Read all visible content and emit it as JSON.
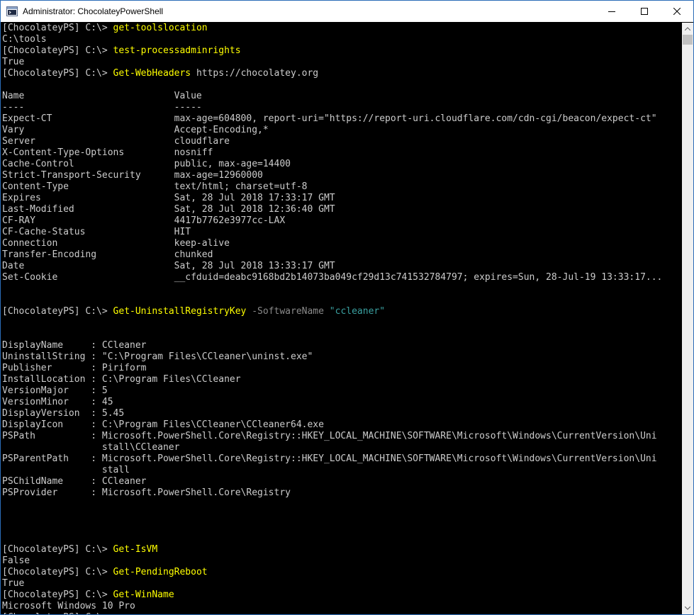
{
  "window": {
    "title": "Administrator: ChocolateyPowerShell",
    "icons": {
      "app": "powershell-app-icon",
      "minimize": "minimize-icon",
      "maximize": "maximize-icon",
      "close": "close-icon"
    }
  },
  "console": {
    "colors": {
      "background": "#000000",
      "text": "#cccccc",
      "command": "#ffff00",
      "parameter": "#8a8a8a",
      "string": "#3aa0a0"
    },
    "lines": [
      [
        {
          "t": "[ChocolateyPS] C:\\> "
        },
        {
          "t": "get-toolslocation",
          "c": "cmd"
        }
      ],
      [
        {
          "t": "C:\\tools"
        }
      ],
      [
        {
          "t": "[ChocolateyPS] C:\\> "
        },
        {
          "t": "test-processadminrights",
          "c": "cmd"
        }
      ],
      [
        {
          "t": "True"
        }
      ],
      [
        {
          "t": "[ChocolateyPS] C:\\> "
        },
        {
          "t": "Get-WebHeaders",
          "c": "cmd"
        },
        {
          "t": " https://chocolatey.org"
        }
      ],
      [
        {
          "t": ""
        }
      ],
      [
        {
          "t": "Name                           Value"
        }
      ],
      [
        {
          "t": "----                           -----"
        }
      ],
      [
        {
          "t": "Expect-CT                      max-age=604800, report-uri=\"https://report-uri.cloudflare.com/cdn-cgi/beacon/expect-ct\""
        }
      ],
      [
        {
          "t": "Vary                           Accept-Encoding,*"
        }
      ],
      [
        {
          "t": "Server                         cloudflare"
        }
      ],
      [
        {
          "t": "X-Content-Type-Options         nosniff"
        }
      ],
      [
        {
          "t": "Cache-Control                  public, max-age=14400"
        }
      ],
      [
        {
          "t": "Strict-Transport-Security      max-age=12960000"
        }
      ],
      [
        {
          "t": "Content-Type                   text/html; charset=utf-8"
        }
      ],
      [
        {
          "t": "Expires                        Sat, 28 Jul 2018 17:33:17 GMT"
        }
      ],
      [
        {
          "t": "Last-Modified                  Sat, 28 Jul 2018 12:36:40 GMT"
        }
      ],
      [
        {
          "t": "CF-RAY                         4417b7762e3977cc-LAX"
        }
      ],
      [
        {
          "t": "CF-Cache-Status                HIT"
        }
      ],
      [
        {
          "t": "Connection                     keep-alive"
        }
      ],
      [
        {
          "t": "Transfer-Encoding              chunked"
        }
      ],
      [
        {
          "t": "Date                           Sat, 28 Jul 2018 13:33:17 GMT"
        }
      ],
      [
        {
          "t": "Set-Cookie                     __cfduid=deabc9168bd2b14073ba049cf29d13c741532784797; expires=Sun, 28-Jul-19 13:33:17..."
        }
      ],
      [
        {
          "t": ""
        }
      ],
      [
        {
          "t": ""
        }
      ],
      [
        {
          "t": "[ChocolateyPS] C:\\> "
        },
        {
          "t": "Get-UninstallRegistryKey",
          "c": "cmd"
        },
        {
          "t": " -SoftwareName",
          "c": "param"
        },
        {
          "t": " "
        },
        {
          "t": "\"ccleaner\"",
          "c": "str"
        }
      ],
      [
        {
          "t": ""
        }
      ],
      [
        {
          "t": ""
        }
      ],
      [
        {
          "t": "DisplayName     : CCleaner"
        }
      ],
      [
        {
          "t": "UninstallString : \"C:\\Program Files\\CCleaner\\uninst.exe\""
        }
      ],
      [
        {
          "t": "Publisher       : Piriform"
        }
      ],
      [
        {
          "t": "InstallLocation : C:\\Program Files\\CCleaner"
        }
      ],
      [
        {
          "t": "VersionMajor    : 5"
        }
      ],
      [
        {
          "t": "VersionMinor    : 45"
        }
      ],
      [
        {
          "t": "DisplayVersion  : 5.45"
        }
      ],
      [
        {
          "t": "DisplayIcon     : C:\\Program Files\\CCleaner\\CCleaner64.exe"
        }
      ],
      [
        {
          "t": "PSPath          : Microsoft.PowerShell.Core\\Registry::HKEY_LOCAL_MACHINE\\SOFTWARE\\Microsoft\\Windows\\CurrentVersion\\Uni"
        }
      ],
      [
        {
          "t": "                  stall\\CCleaner"
        }
      ],
      [
        {
          "t": "PSParentPath    : Microsoft.PowerShell.Core\\Registry::HKEY_LOCAL_MACHINE\\SOFTWARE\\Microsoft\\Windows\\CurrentVersion\\Uni"
        }
      ],
      [
        {
          "t": "                  stall"
        }
      ],
      [
        {
          "t": "PSChildName     : CCleaner"
        }
      ],
      [
        {
          "t": "PSProvider      : Microsoft.PowerShell.Core\\Registry"
        }
      ],
      [
        {
          "t": ""
        }
      ],
      [
        {
          "t": ""
        }
      ],
      [
        {
          "t": ""
        }
      ],
      [
        {
          "t": ""
        }
      ],
      [
        {
          "t": "[ChocolateyPS] C:\\> "
        },
        {
          "t": "Get-IsVM",
          "c": "cmd"
        }
      ],
      [
        {
          "t": "False"
        }
      ],
      [
        {
          "t": "[ChocolateyPS] C:\\> "
        },
        {
          "t": "Get-PendingReboot",
          "c": "cmd"
        }
      ],
      [
        {
          "t": "True"
        }
      ],
      [
        {
          "t": "[ChocolateyPS] C:\\> "
        },
        {
          "t": "Get-WinName",
          "c": "cmd"
        }
      ],
      [
        {
          "t": "Microsoft Windows 10 Pro"
        }
      ],
      [
        {
          "t": "[ChocolateyPS] C:\\> "
        }
      ]
    ]
  },
  "scrollbar": {
    "icons": {
      "up": "scroll-up-arrow-icon",
      "down": "scroll-down-arrow-icon"
    }
  }
}
